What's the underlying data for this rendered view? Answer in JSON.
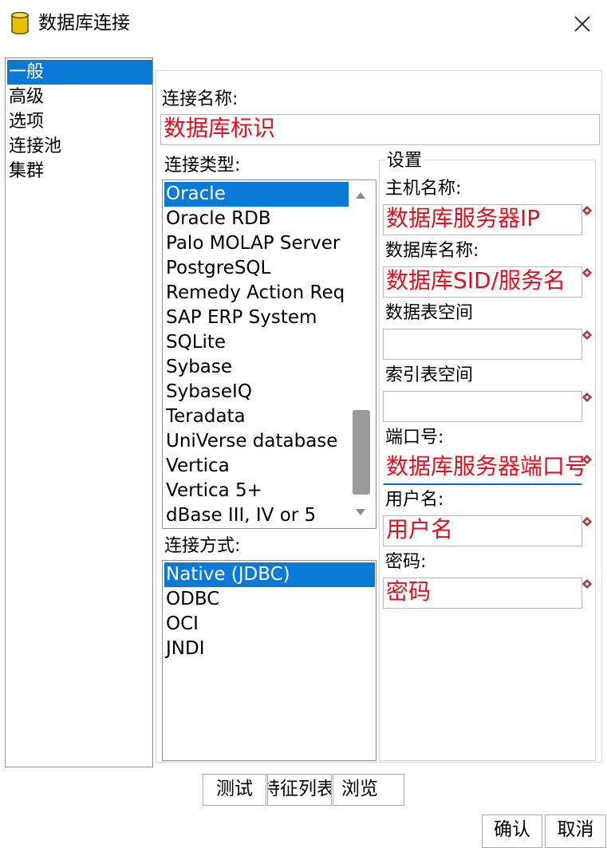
{
  "window": {
    "title": "数据库连接",
    "icon": "database-icon",
    "close_icon": "close-icon"
  },
  "nav": {
    "items": [
      {
        "label": "一般",
        "selected": true
      },
      {
        "label": "高级",
        "selected": false
      },
      {
        "label": "选项",
        "selected": false
      },
      {
        "label": "连接池",
        "selected": false
      },
      {
        "label": "集群",
        "selected": false
      }
    ]
  },
  "form": {
    "connection_name_label": "连接名称:",
    "connection_name_value": "数据库标识",
    "connection_type_label": "连接类型:",
    "connection_types": [
      "Oracle",
      "Oracle RDB",
      "Palo MOLAP Server",
      "PostgreSQL",
      "Remedy Action Req",
      "SAP ERP System",
      "SQLite",
      "Sybase",
      "SybaseIQ",
      "Teradata",
      "UniVerse database",
      "Vertica",
      "Vertica 5+",
      "dBase III, IV or 5"
    ],
    "connection_type_selected": "Oracle",
    "access_label": "连接方式:",
    "access_methods": [
      "Native (JDBC)",
      "ODBC",
      "OCI",
      "JNDI"
    ],
    "access_selected": "Native (JDBC)"
  },
  "settings": {
    "group_label": "设置",
    "host_label": "主机名称:",
    "host_value": "数据库服务器IP",
    "db_label": "数据库名称:",
    "db_value": "数据库SID/服务名",
    "data_tablespace_label": "数据表空间",
    "data_tablespace_value": "",
    "index_tablespace_label": "索引表空间",
    "index_tablespace_value": "",
    "port_label": "端口号:",
    "port_value": "数据库服务器端口号",
    "user_label": "用户名:",
    "user_value": "用户名",
    "password_label": "密码:",
    "password_value": "密码",
    "required_icon": "required-diamond-icon"
  },
  "buttons": {
    "test": "测试",
    "features": "特征列表",
    "explore": "浏览",
    "ok": "确认",
    "cancel": "取消"
  },
  "colors": {
    "selection": "#0b79d6",
    "annotation_text": "#e0101e",
    "focus_underline": "#0a64d1"
  }
}
